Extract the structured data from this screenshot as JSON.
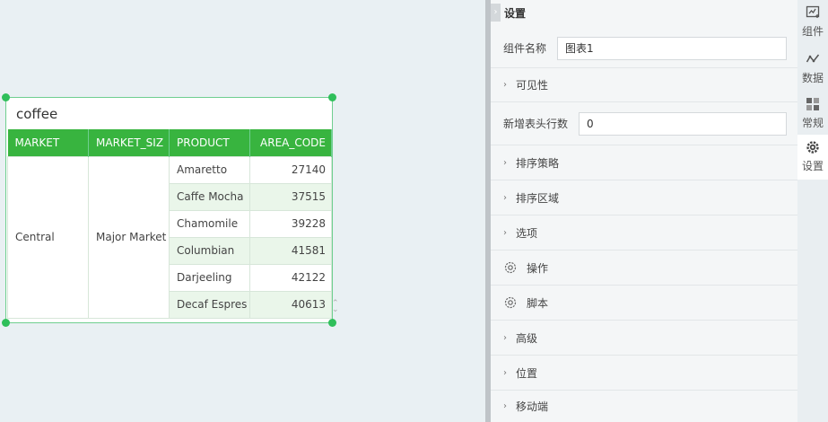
{
  "widget": {
    "title": "coffee",
    "columns": [
      "MARKET",
      "MARKET_SIZ",
      "PRODUCT",
      "AREA_CODE"
    ],
    "market": "Central",
    "market_size": "Major Market",
    "rows": [
      {
        "product": "Amaretto",
        "area_code": "27140"
      },
      {
        "product": "Caffe Mocha",
        "area_code": "37515"
      },
      {
        "product": "Chamomile",
        "area_code": "39228"
      },
      {
        "product": "Columbian",
        "area_code": "41581"
      },
      {
        "product": "Darjeeling",
        "area_code": "42122"
      },
      {
        "product": "Decaf Espres",
        "area_code": "40613"
      }
    ],
    "accent_color": "#38b43f"
  },
  "panel": {
    "header": "设置",
    "component_name_label": "组件名称",
    "component_name_value": "图表1",
    "visibility": "可见性",
    "extra_header_rows_label": "新增表头行数",
    "extra_header_rows_value": "0",
    "sort_strategy": "排序策略",
    "sort_area": "排序区域",
    "options": "选项",
    "actions": "操作",
    "script": "脚本",
    "advanced": "高级",
    "position": "位置",
    "mobile": "移动端"
  },
  "tabs": [
    {
      "label": "组件",
      "icon": "component-icon"
    },
    {
      "label": "数据",
      "icon": "data-icon"
    },
    {
      "label": "常规",
      "icon": "general-icon"
    },
    {
      "label": "设置",
      "icon": "settings-gear-icon"
    }
  ]
}
